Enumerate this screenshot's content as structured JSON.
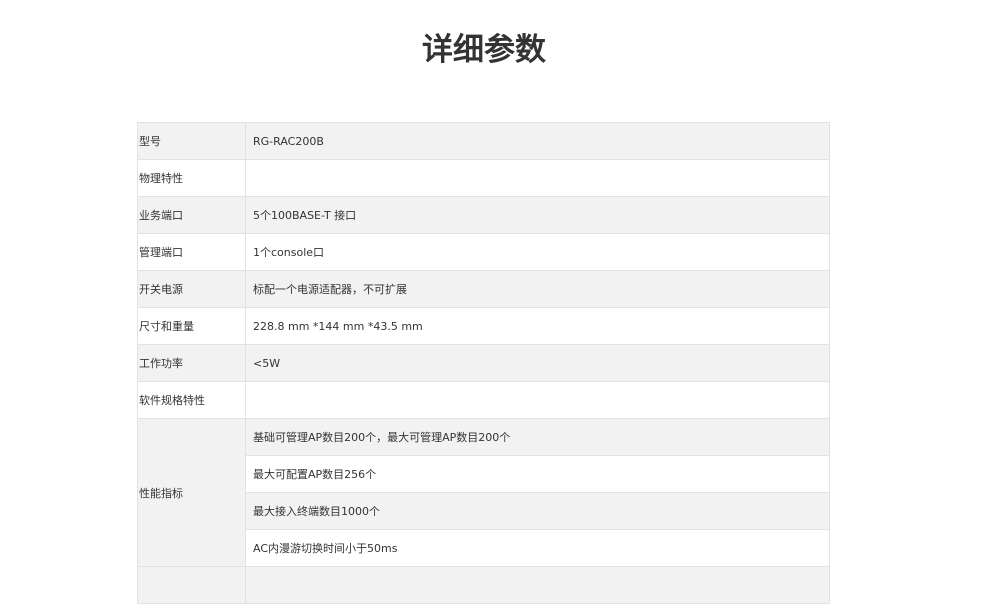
{
  "page": {
    "title": "详细参数"
  },
  "specs": {
    "rows": [
      {
        "label": "型号",
        "value": "RG-RAC200B"
      },
      {
        "label": "物理特性",
        "value": ""
      },
      {
        "label": "业务端口",
        "value": "5个100BASE-T 接口"
      },
      {
        "label": "管理端口",
        "value": "1个console口"
      },
      {
        "label": "开关电源",
        "value": "标配一个电源适配器，不可扩展"
      },
      {
        "label": "尺寸和重量",
        "value": "228.8 mm *144 mm *43.5 mm"
      },
      {
        "label": "工作功率",
        "value": "<5W"
      },
      {
        "label": "软件规格特性",
        "value": ""
      }
    ],
    "performance": {
      "label": "性能指标",
      "values": [
        "基础可管理AP数目200个，最大可管理AP数目200个",
        "最大可配置AP数目256个",
        "最大接入终端数目1000个",
        "AC内漫游切换时间小于50ms"
      ]
    }
  }
}
